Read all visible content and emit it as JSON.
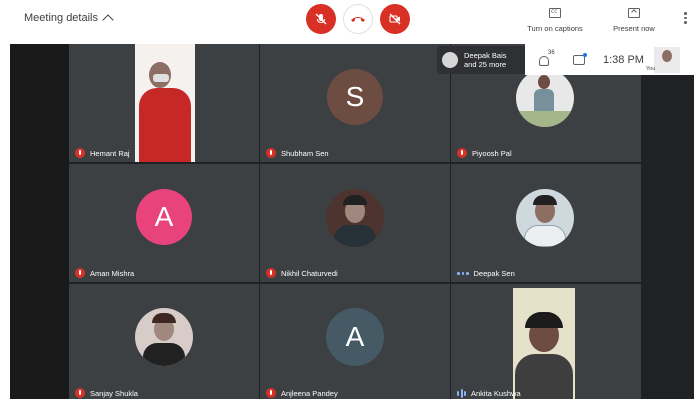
{
  "header": {
    "meeting_details": "Meeting details",
    "captions_label": "Turn on captions",
    "present_label": "Present now"
  },
  "overlay": {
    "others_line1": "Deepak Bais",
    "others_line2": "and 25 more",
    "people_count": "36",
    "time": "1:38 PM",
    "self_label": "You"
  },
  "colors": {
    "end_call": "#d93025",
    "tile_bg": "#3c4043",
    "stage_bg": "#202124",
    "accent_blue": "#8ab4f8"
  },
  "participants": [
    {
      "name": "Hemant Raj",
      "status": "muted",
      "tile": "video"
    },
    {
      "name": "Shubham Sen",
      "status": "muted",
      "tile": "avatar",
      "initial": "S",
      "avatar_color": "#6d4c41"
    },
    {
      "name": "Piyoosh Pal",
      "status": "muted",
      "tile": "photo"
    },
    {
      "name": "Aman Mishra",
      "status": "muted",
      "tile": "avatar",
      "initial": "A",
      "avatar_color": "#e8437b"
    },
    {
      "name": "Nikhil Chaturvedi",
      "status": "muted",
      "tile": "photo"
    },
    {
      "name": "Deepak Sen",
      "status": "dots",
      "tile": "photo"
    },
    {
      "name": "Sanjay Shukla",
      "status": "muted",
      "tile": "photo"
    },
    {
      "name": "Anjleena Pandey",
      "status": "muted",
      "tile": "avatar",
      "initial": "A",
      "avatar_color": "#455a64"
    },
    {
      "name": "Ankita Kushwa",
      "status": "speaking",
      "tile": "video"
    }
  ]
}
